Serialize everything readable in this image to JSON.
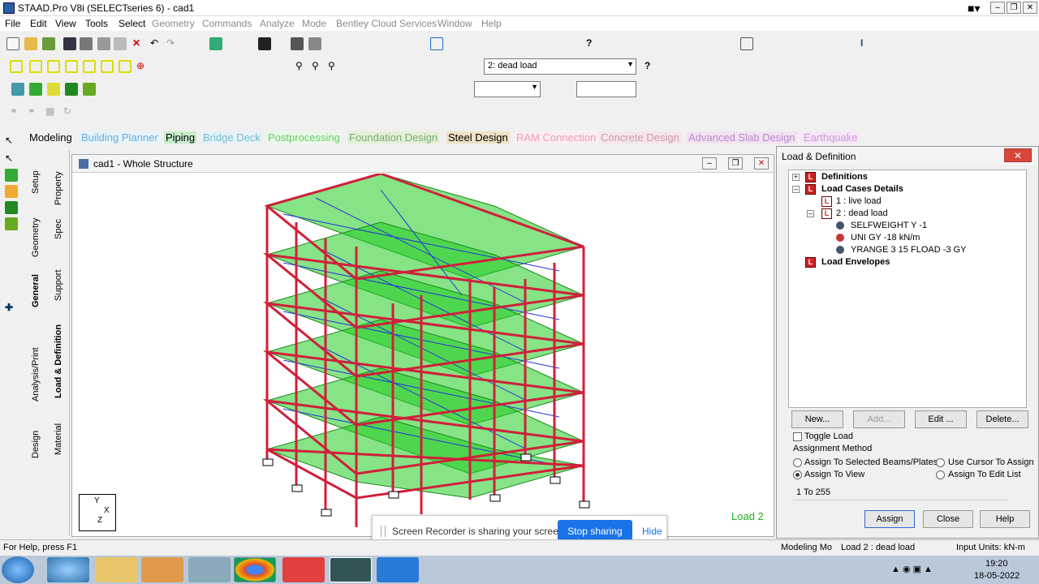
{
  "window": {
    "title": "STAAD.Pro V8i (SELECTseries 6) - cad1"
  },
  "menu": [
    "File",
    "Edit",
    "View",
    "Tools",
    "Select",
    "Geometry",
    "Commands",
    "Analyze",
    "Mode",
    "Bentley Cloud Services",
    "Window",
    "Help"
  ],
  "toolbar": {
    "load_case_select": "2: dead load"
  },
  "mode_tabs": [
    "Modeling",
    "Building Planner",
    "Piping",
    "Bridge Deck",
    "Postprocessing",
    "Foundation Design",
    "Steel Design",
    "RAM Connection",
    "Concrete Design",
    "Advanced Slab Design",
    "Earthquake"
  ],
  "side_tabs_outer": [
    "Setup",
    "Geometry",
    "General",
    "Analysis/Print",
    "Design"
  ],
  "side_tabs_inner": [
    "Property",
    "Spec",
    "Support",
    "Load & Definition",
    "Material"
  ],
  "view": {
    "title": "cad1 - Whole Structure",
    "load_label": "Load 2",
    "axis_y": "Y",
    "axis_x": "X",
    "axis_z": "Z"
  },
  "panel": {
    "title": "Load & Definition",
    "tree": {
      "definitions": "Definitions",
      "load_cases": "Load Cases Details",
      "case1": "1 : live load",
      "case2": "2 : dead load",
      "item1": "SELFWEIGHT Y -1",
      "item2": "UNI GY -18 kN/m",
      "item3": "YRANGE 3 15 FLOAD -3 GY",
      "envelopes": "Load Envelopes"
    },
    "new_btn": "New...",
    "add_btn": "Add...",
    "edit_btn": "Edit ...",
    "delete_btn": "Delete...",
    "toggle_load": "Toggle Load",
    "assignment_method": "Assignment Method",
    "opt_selected": "Assign To Selected Beams/Plates",
    "opt_cursor": "Use Cursor To Assign",
    "opt_view": "Assign To View",
    "opt_edit": "Assign To Edit List",
    "range_value": "1 To 255",
    "assign_btn": "Assign",
    "close_btn": "Close",
    "help_btn": "Help"
  },
  "share": {
    "message": "Screen Recorder is sharing your screen.",
    "stop": "Stop sharing",
    "hide": "Hide"
  },
  "status": {
    "help": "For Help, press F1",
    "mode": "Modeling Mo",
    "load": "Load 2 : dead load",
    "units": "Input Units:  kN-m"
  },
  "clock": {
    "time": "19:20",
    "date": "18-05-2022"
  }
}
